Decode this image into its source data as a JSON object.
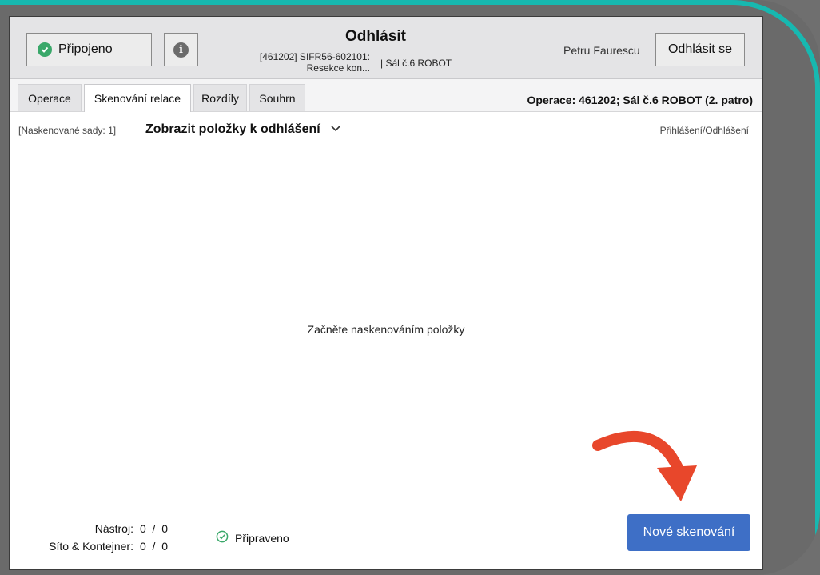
{
  "header": {
    "status_label": "Připojeno",
    "title": "Odhlásit",
    "subtitle_line1": "[461202] SIFR56-602101:",
    "subtitle_line2": "Resekce kon...",
    "subtitle_room": "|  Sál č.6 ROBOT",
    "user_name": "Petru Faurescu",
    "logout_label": "Odhlásit se"
  },
  "tabs": [
    {
      "label": "Operace",
      "active": false
    },
    {
      "label": "Skenování relace",
      "active": true
    },
    {
      "label": "Rozdíly",
      "active": false
    },
    {
      "label": "Souhrn",
      "active": false
    }
  ],
  "operation_info": "Operace:  461202; Sál č.6 ROBOT (2. patro)",
  "subbar": {
    "scanned_sets": "[Naskenované sady: 1]",
    "show_items": "Zobrazit položky k odhlášení",
    "login_logout": "Přihlášení/Odhlášení"
  },
  "main": {
    "empty_message": "Začněte naskenováním položky"
  },
  "footer": {
    "tool_label": "Nástroj:",
    "tool_count": "0  /  0",
    "sieve_label": "Síto & Kontejner:",
    "sieve_count": "0  /  0",
    "ready_label": "Připraveno",
    "new_scan_label": "Nové skenování"
  },
  "colors": {
    "accent": "#3e6fc6",
    "status_green": "#3aa86a",
    "annotation_arrow": "#e8472b",
    "rim_teal": "#17b8b0"
  }
}
